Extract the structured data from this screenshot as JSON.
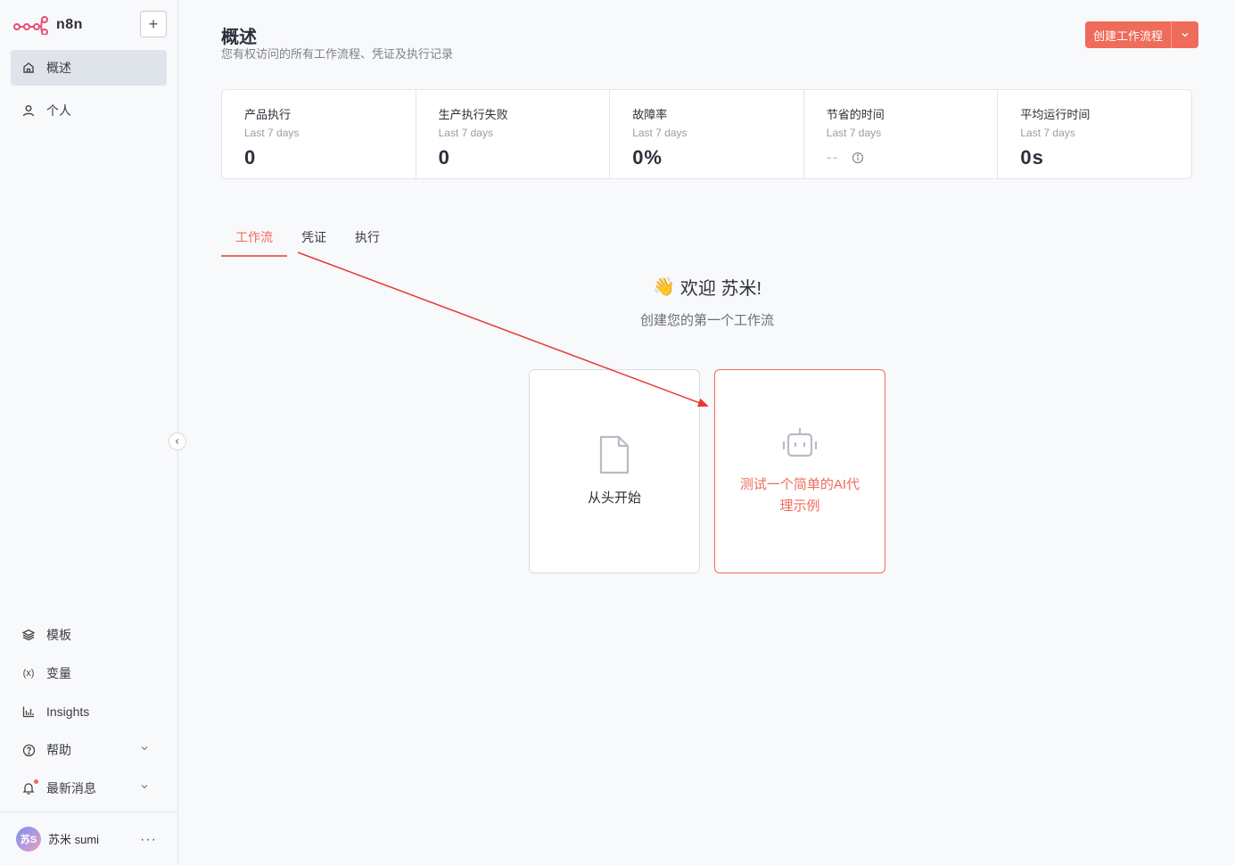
{
  "sidebar": {
    "logo_text": "n8n",
    "nav": [
      {
        "label": "概述"
      },
      {
        "label": "个人"
      }
    ],
    "bottom": [
      {
        "label": "模板"
      },
      {
        "label": "变量"
      },
      {
        "label": "Insights"
      },
      {
        "label": "帮助"
      },
      {
        "label": "最新消息"
      }
    ],
    "user": {
      "avatar": "苏S",
      "name": "苏米 sumi",
      "more": "···"
    }
  },
  "header": {
    "title": "概述",
    "subtitle": "您有权访问的所有工作流程、凭证及执行记录",
    "create_button": "创建工作流程"
  },
  "stats": [
    {
      "label": "产品执行",
      "period": "Last 7 days",
      "value": "0"
    },
    {
      "label": "生产执行失败",
      "period": "Last 7 days",
      "value": "0"
    },
    {
      "label": "故障率",
      "period": "Last 7 days",
      "value": "0%"
    },
    {
      "label": "节省的时间",
      "period": "Last 7 days",
      "value": "--"
    },
    {
      "label": "平均运行时间",
      "period": "Last 7 days",
      "value": "0s"
    }
  ],
  "tabs": [
    {
      "label": "工作流"
    },
    {
      "label": "凭证"
    },
    {
      "label": "执行"
    }
  ],
  "welcome": {
    "title": "欢迎 苏米!",
    "subtitle": "创建您的第一个工作流"
  },
  "cards": {
    "scratch": "从头开始",
    "ai": "测试一个简单的AI代理示例"
  },
  "colors": {
    "accent": "#ef6b5a",
    "active_nav": "#dfe3ea",
    "annotation_arrow": "#e53935"
  }
}
